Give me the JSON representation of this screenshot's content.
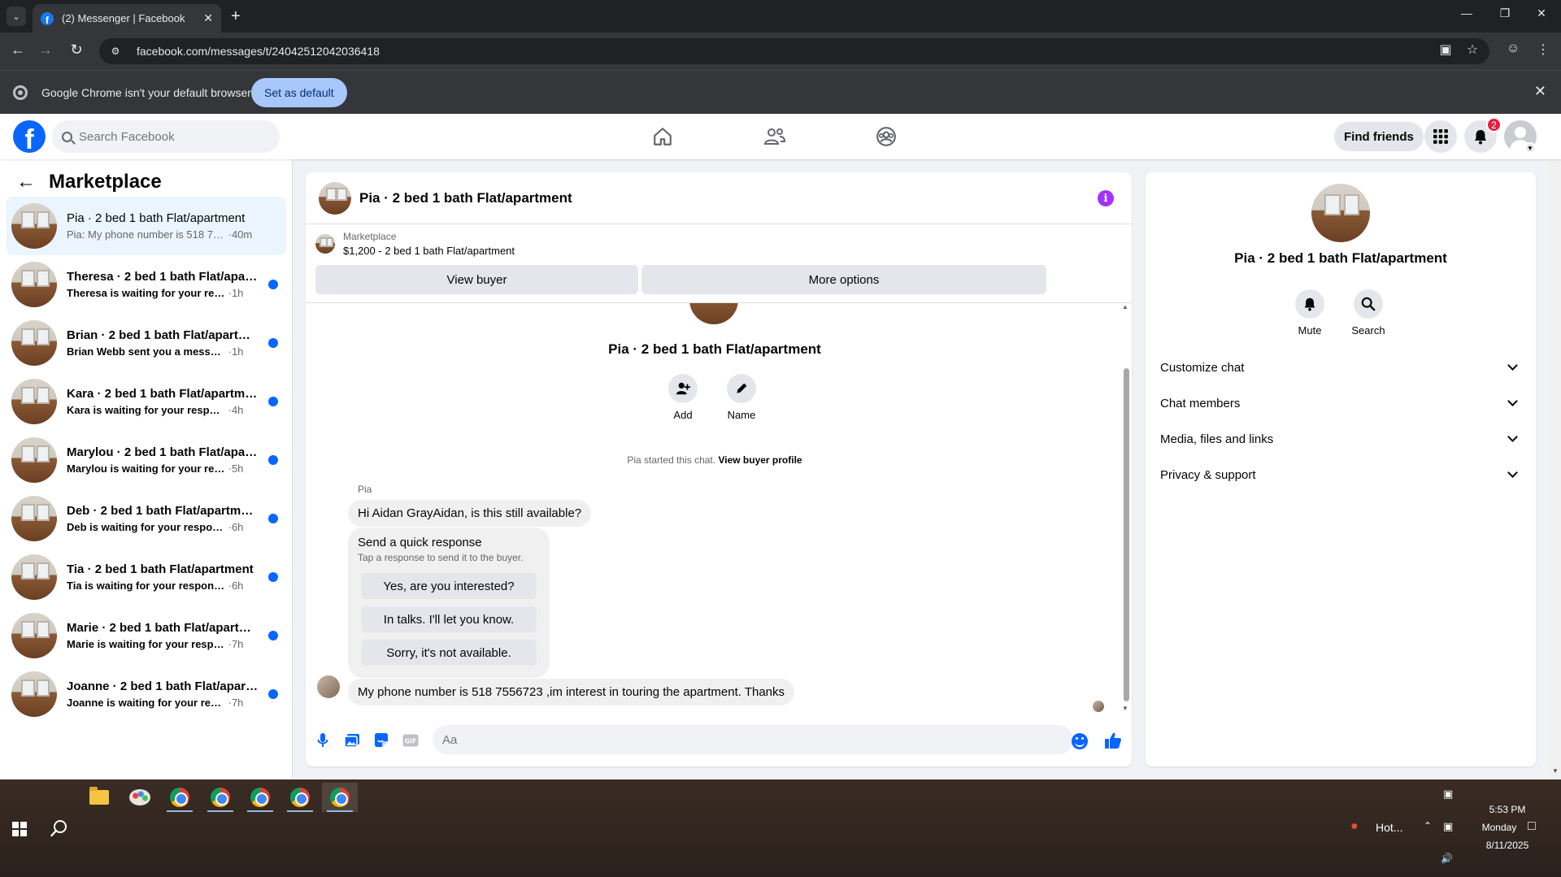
{
  "browser": {
    "tab_title": "(2) Messenger | Facebook",
    "new_tab_label": "+",
    "url": "facebook.com/messages/t/24042512042036418",
    "infobar_text": "Google Chrome isn't your default browser",
    "set_default_label": "Set as default"
  },
  "fb_header": {
    "search_placeholder": "Search Facebook",
    "find_friends_label": "Find friends",
    "notification_count": "2"
  },
  "sidebar": {
    "title": "Marketplace",
    "conversations": [
      {
        "name": "Pia · 2 bed 1 bath Flat/apartment",
        "preview": "Pia: My phone number is 518 75567...",
        "time": "40m",
        "unread": false,
        "active": true
      },
      {
        "name": "Theresa · 2 bed 1 bath Flat/apart...",
        "preview": "Theresa is waiting for your respon...",
        "time": "1h",
        "unread": true,
        "active": false
      },
      {
        "name": "Brian · 2 bed 1 bath Flat/apartme...",
        "preview": "Brian Webb sent you a message a...",
        "time": "1h",
        "unread": true,
        "active": false
      },
      {
        "name": "Kara · 2 bed 1 bath Flat/apartment",
        "preview": "Kara is waiting for your response.",
        "time": "4h",
        "unread": true,
        "active": false
      },
      {
        "name": "Marylou · 2 bed 1 bath Flat/apart...",
        "preview": "Marylou is waiting for your respon...",
        "time": "5h",
        "unread": true,
        "active": false
      },
      {
        "name": "Deb · 2 bed 1 bath Flat/apartment",
        "preview": "Deb is waiting for your response.",
        "time": "6h",
        "unread": true,
        "active": false
      },
      {
        "name": "Tia · 2 bed 1 bath Flat/apartment",
        "preview": "Tia is waiting for your response.",
        "time": "6h",
        "unread": true,
        "active": false
      },
      {
        "name": "Marie · 2 bed 1 bath Flat/apartm...",
        "preview": "Marie is waiting for your response.",
        "time": "7h",
        "unread": true,
        "active": false
      },
      {
        "name": "Joanne · 2 bed 1 bath Flat/apart...",
        "preview": "Joanne is waiting for your response.",
        "time": "7h",
        "unread": true,
        "active": false
      }
    ]
  },
  "chat": {
    "title": "Pia · 2 bed 1 bath Flat/apartment",
    "marketplace_label": "Marketplace",
    "listing_summary": "$1,200 - 2 bed 1 bath Flat/apartment",
    "view_buyer_label": "View buyer",
    "more_options_label": "More options",
    "intro_title": "Pia · 2 bed 1 bath Flat/apartment",
    "add_label": "Add",
    "name_label": "Name",
    "started_text": "Pia started this chat.",
    "view_buyer_profile_label": "View buyer profile",
    "sender_name": "Pia",
    "message_1": "Hi Aidan GrayAidan, is this still available?",
    "quick_title": "Send a quick response",
    "quick_subtitle": "Tap a response to send it to the buyer.",
    "quick_options": [
      "Yes, are you interested?",
      "In talks. I'll let you know.",
      "Sorry, it's not available."
    ],
    "message_2": "My phone number is 518 7556723 ,im interest in touring the apartment. Thanks",
    "composer_placeholder": "Aa"
  },
  "right_panel": {
    "title": "Pia · 2 bed 1 bath Flat/apartment",
    "mute_label": "Mute",
    "search_label": "Search",
    "sections": [
      "Customize chat",
      "Chat members",
      "Media, files and links",
      "Privacy & support"
    ]
  },
  "taskbar": {
    "weather_text": "Hot...",
    "time": "5:53 PM",
    "day": "Monday",
    "date": "8/11/2025"
  },
  "colors": {
    "facebook_blue": "#0866ff",
    "unread_dot": "#0866ff",
    "info_purple": "#a033ff",
    "badge_red": "#e41e3f"
  }
}
